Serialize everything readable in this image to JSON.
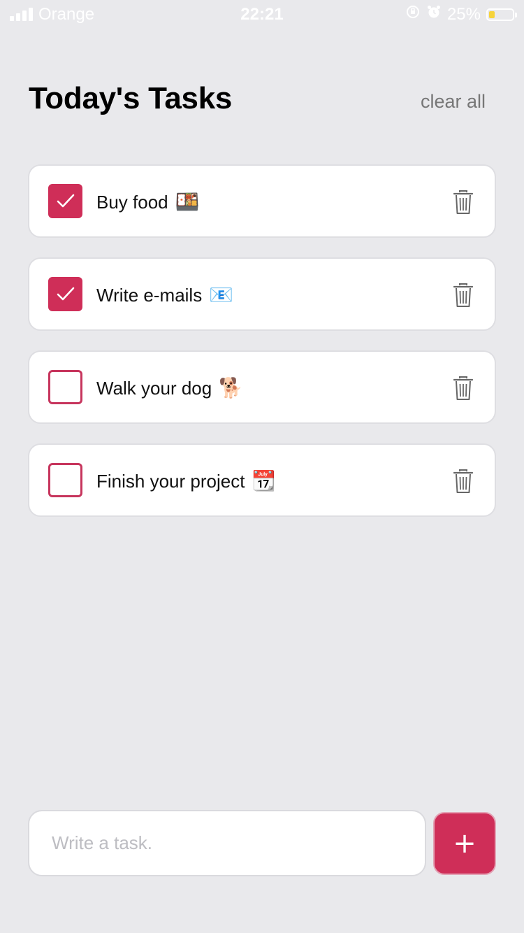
{
  "status_bar": {
    "carrier": "Orange",
    "time": "22:21",
    "battery_percent": "25%",
    "battery_level": 0.25,
    "battery_color": "#f6d33b",
    "icons": [
      "signal-icon",
      "orientation-lock-icon",
      "alarm-icon",
      "battery-icon"
    ]
  },
  "header": {
    "title": "Today's Tasks",
    "clear_all_label": "clear all"
  },
  "tasks": [
    {
      "label": "Buy food",
      "emoji": "🍱",
      "checked": true
    },
    {
      "label": "Write e-mails",
      "emoji": "📧",
      "checked": true
    },
    {
      "label": "Walk your dog",
      "emoji": "🐕",
      "checked": false
    },
    {
      "label": "Finish your project",
      "emoji": "📆",
      "checked": false
    }
  ],
  "input": {
    "value": "",
    "placeholder": "Write a task."
  },
  "add_button": {
    "label": "+"
  },
  "colors": {
    "accent": "#cf2e58",
    "background": "#e9e9ec",
    "card": "#ffffff",
    "muted_text": "#777777"
  }
}
